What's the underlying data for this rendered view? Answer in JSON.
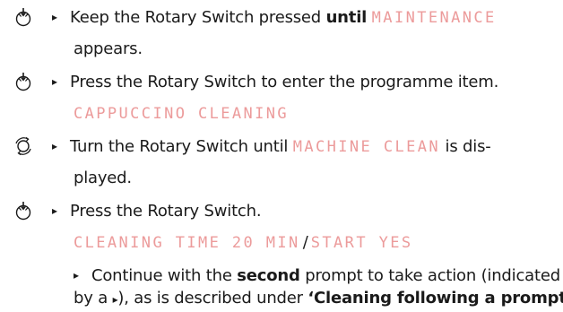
{
  "steps": [
    {
      "icon": "rotary-press-icon",
      "a": "Keep the Rotary Switch pressed ",
      "b": "until",
      "lcd": "MAINTENANCE",
      "cont": "appears."
    },
    {
      "icon": "rotary-press-icon",
      "a": "Press the Rotary Switch to enter the programme item.",
      "lcd": "CAPPUCCINO CLEANING"
    },
    {
      "icon": "rotary-turn-icon",
      "a": "Turn the Rotary Switch until ",
      "lcd": "MACHINE CLEAN",
      "a2": " is dis-",
      "cont": "played."
    },
    {
      "icon": "rotary-press-icon",
      "a": "Press the Rotary Switch.",
      "lcd1": "CLEANING TIME 20 MIN",
      "sep": "/",
      "lcd2": "START YES"
    },
    {
      "a": "Continue with the ",
      "b": "second",
      "a2": " prompt to take action (indicated",
      "cont_a": "by a ",
      "cont_arrow": "▸",
      "cont_b": "), as is described under ",
      "cont_bold": "‘Cleaning following a prompt’",
      "cont_end": "."
    }
  ],
  "bullet": "▸"
}
